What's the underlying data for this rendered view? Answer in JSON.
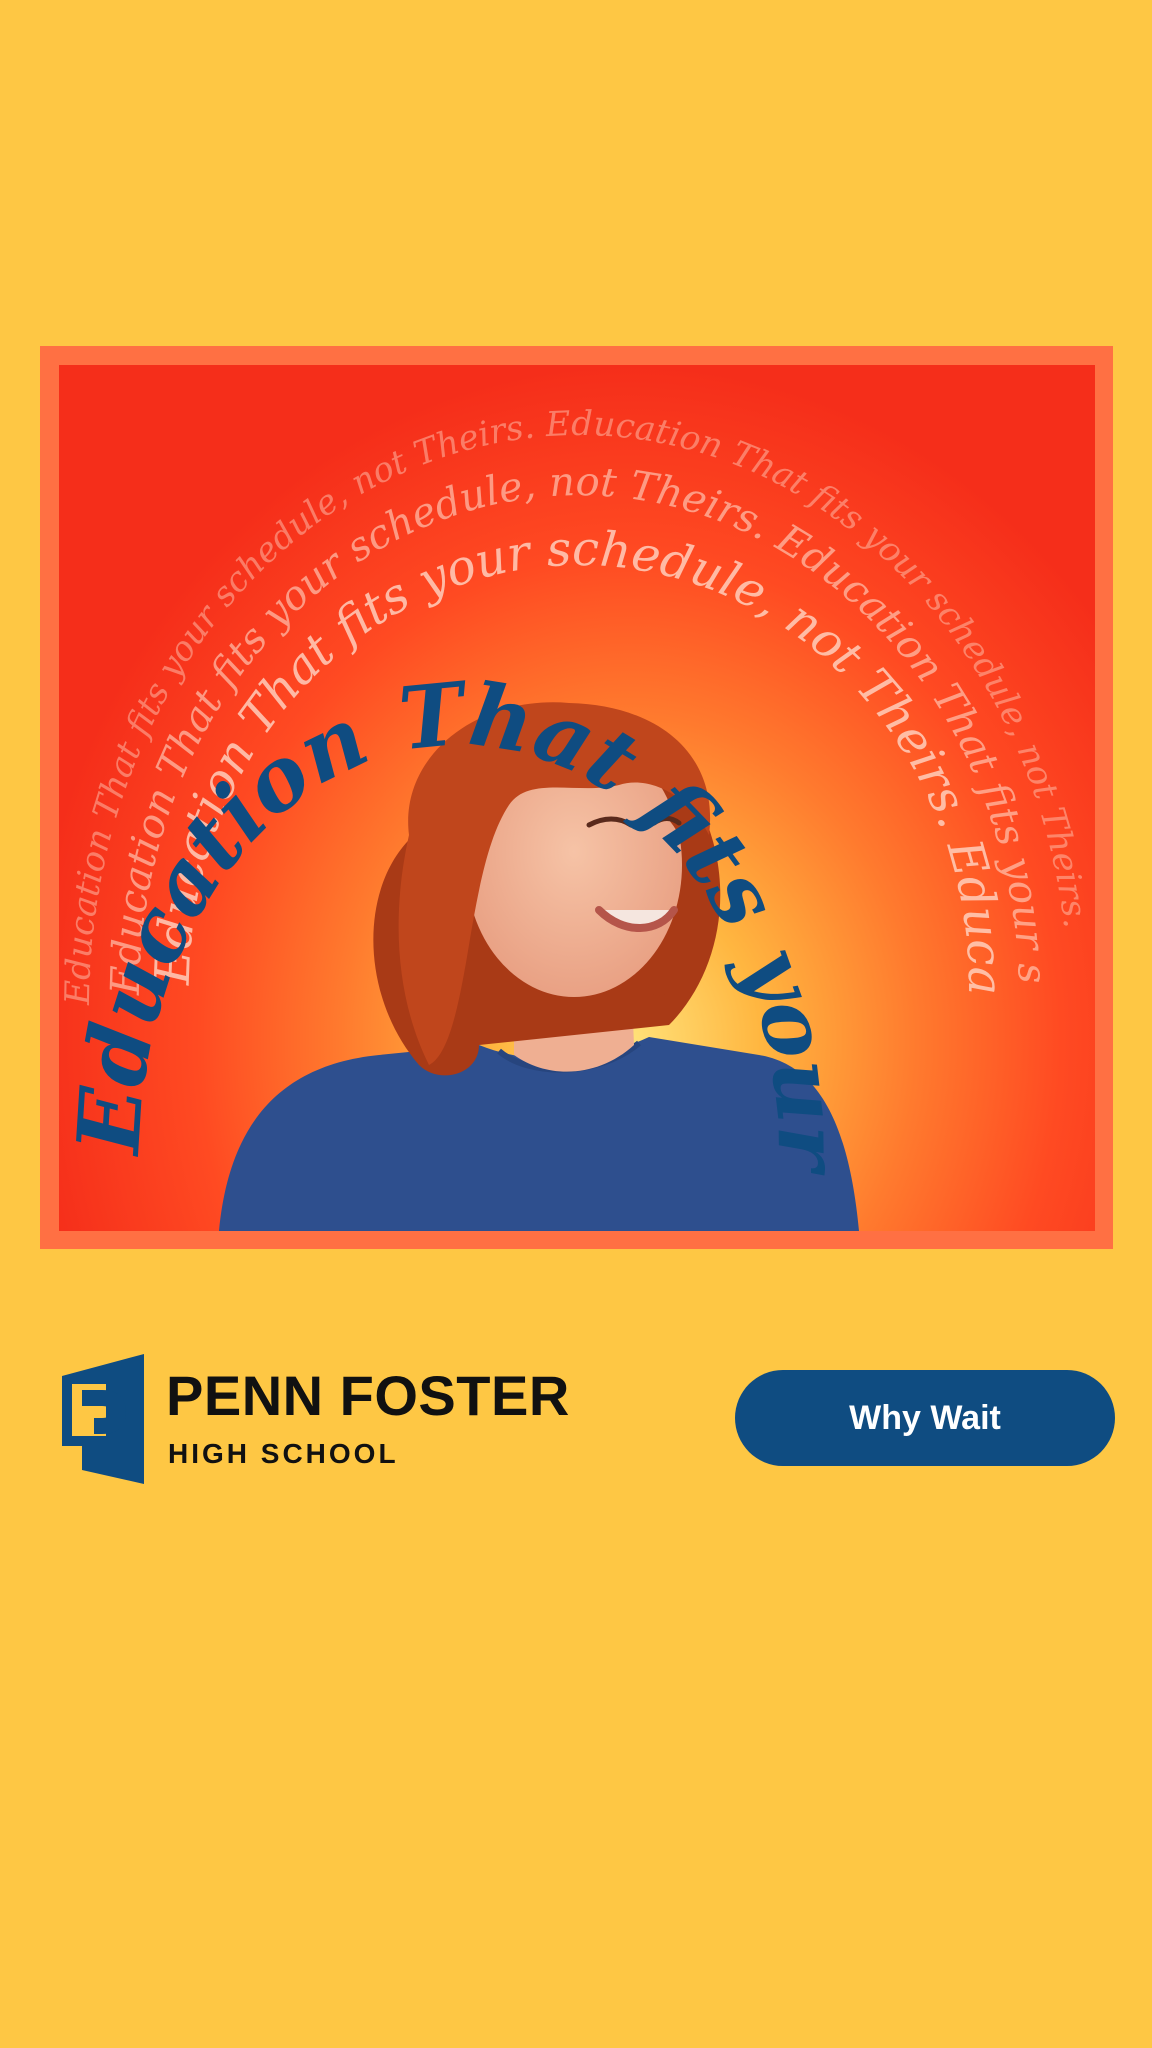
{
  "ad": {
    "tagline_main": "Education That fits your schedule, not Theirs.",
    "tagline_repeat": "Education That fits your schedule, not Theirs. Education That fits your schedule, not Theirs.",
    "colors": {
      "background": "#FEC744",
      "frame": "#FF7043",
      "tagline_main": "#0F4C81",
      "tagline_faded": "#FFD3C2",
      "shirt": "#2E4F8E",
      "hair": "#C0461C"
    }
  },
  "brand": {
    "name": "PENN FOSTER",
    "subtitle": "HIGH SCHOOL",
    "logo_icon": "penn-foster-logo-icon"
  },
  "cta": {
    "label": "Why Wait",
    "color": "#0F4C81"
  }
}
